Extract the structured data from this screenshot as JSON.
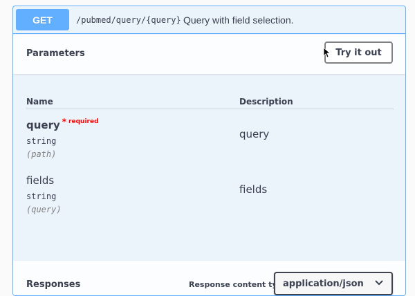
{
  "operation": {
    "method": "GET",
    "path": "/pubmed/query/{query}",
    "summary": "Query with field selection."
  },
  "parameters_section": {
    "title": "Parameters",
    "try_button_label": "Try it out",
    "columns": {
      "name": "Name",
      "description": "Description"
    },
    "params": [
      {
        "name": "query",
        "required_star": "*",
        "required_label": "required",
        "type": "string",
        "in": "(path)",
        "description": "query"
      },
      {
        "name": "fields",
        "type": "string",
        "in": "(query)",
        "description": "fields"
      }
    ]
  },
  "responses_section": {
    "title": "Responses",
    "content_type_label": "Response content type",
    "content_type_value": "application/json"
  },
  "colors": {
    "get_accent": "#61affe",
    "block_bg": "#ebf3fb",
    "required_red": "#ff0000"
  },
  "icons": {
    "cursor": "mouse-pointer-icon",
    "select": "chevron-down-icon"
  }
}
